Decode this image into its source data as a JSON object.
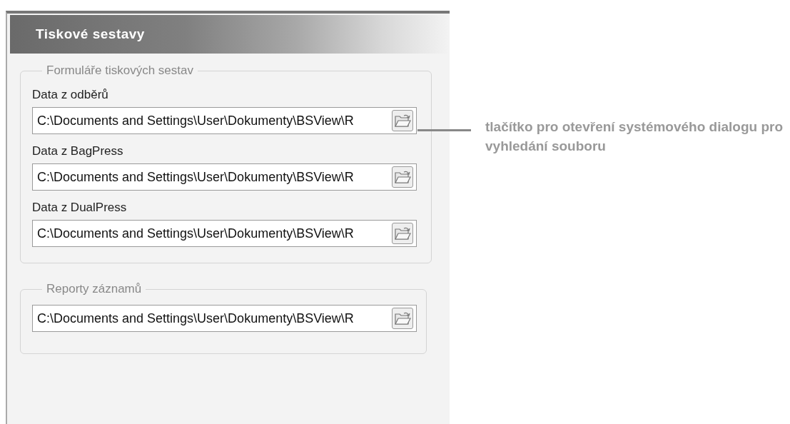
{
  "panel": {
    "title": "Tiskové sestavy"
  },
  "groups": [
    {
      "legend": "Formuláře tiskových sestav",
      "fields": [
        {
          "label": "Data z odběrů",
          "value": "C:\\Documents and Settings\\User\\Dokumenty\\BSView\\R"
        },
        {
          "label": "Data z BagPress",
          "value": "C:\\Documents and Settings\\User\\Dokumenty\\BSView\\R"
        },
        {
          "label": "Data z DualPress",
          "value": "C:\\Documents and Settings\\User\\Dokumenty\\BSView\\R"
        }
      ]
    },
    {
      "legend": "Reporty záznamů",
      "fields": [
        {
          "value": "C:\\Documents and Settings\\User\\Dokumenty\\BSView\\R"
        }
      ]
    }
  ],
  "callout": {
    "text": "tlačítko pro otevření systémového dialogu pro vyhledání souboru"
  }
}
